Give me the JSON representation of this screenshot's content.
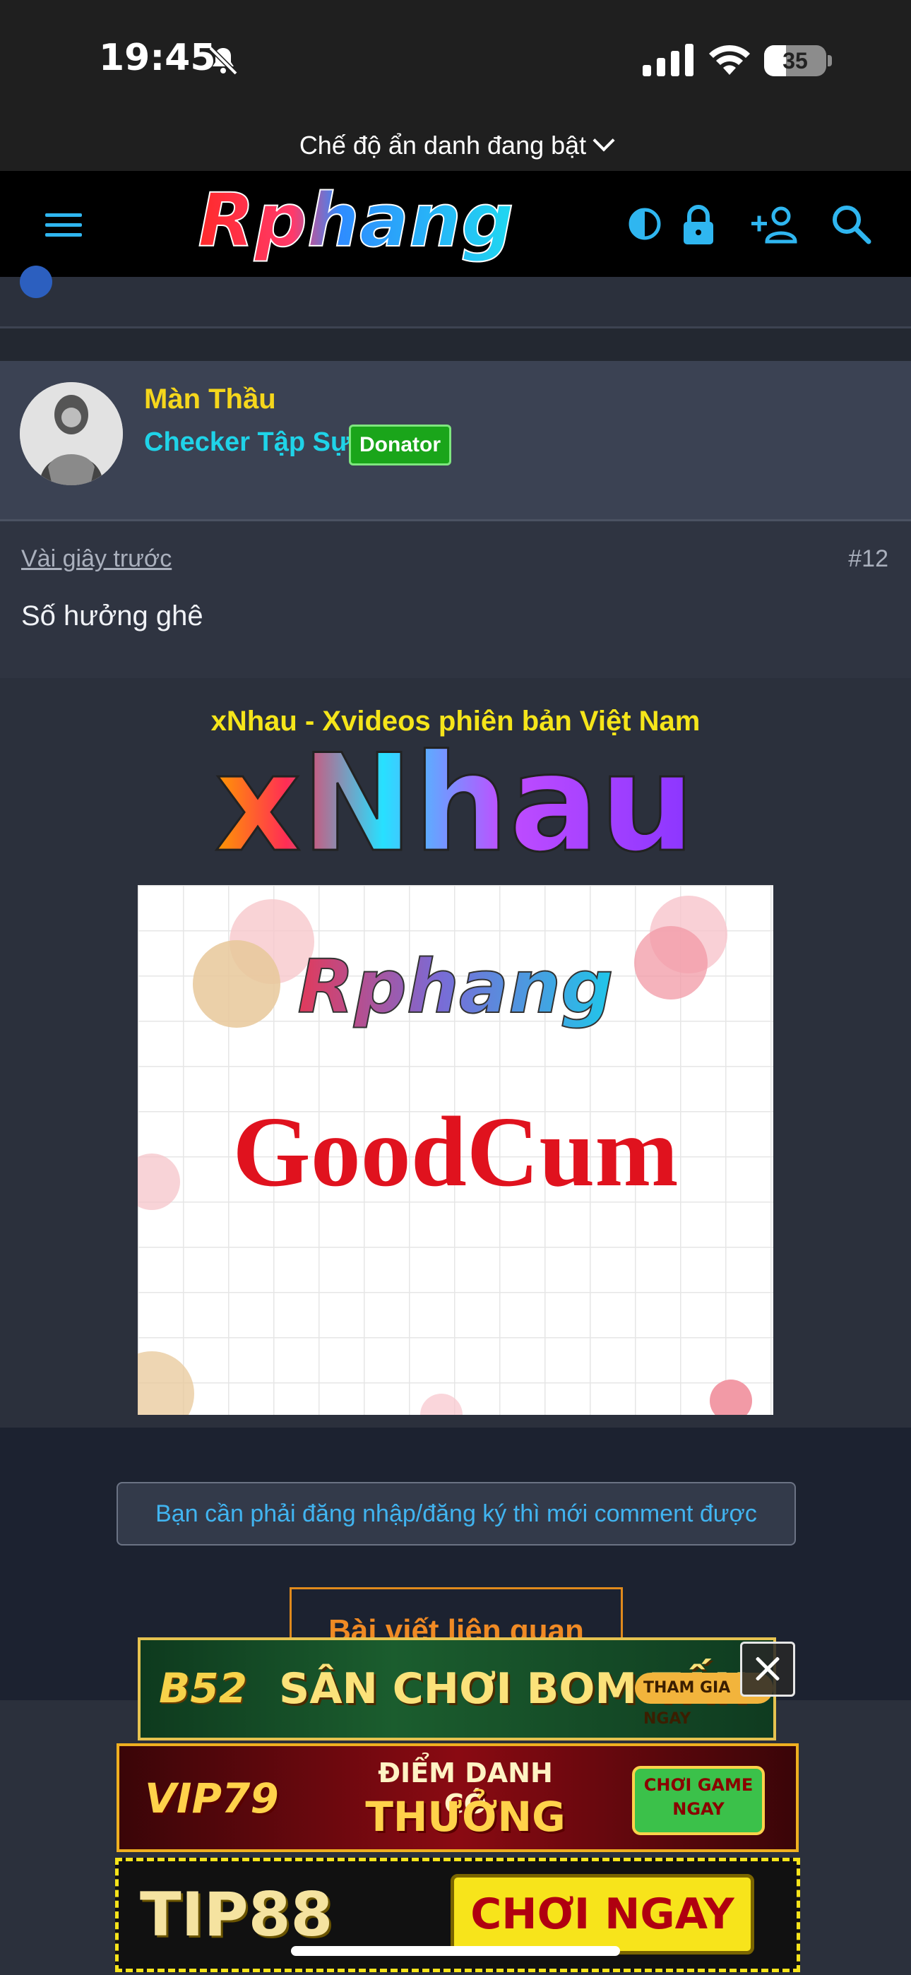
{
  "status_bar": {
    "time": "19:45",
    "battery": "35",
    "battery_level": 0.35
  },
  "browser": {
    "incognito_label": "Chế độ ẩn danh đang bật"
  },
  "header": {
    "logo_text": "Rphang",
    "icons": [
      "menu-icon",
      "contrast-toggle-icon",
      "lock-icon",
      "add-user-icon",
      "search-icon"
    ]
  },
  "post": {
    "username": "Màn Thầu",
    "user_title": "Checker Tập Sự",
    "badge": "Donator",
    "time": "Vài giây trước",
    "post_number": "#12",
    "body": "Số hưởng ghê"
  },
  "ad": {
    "caption": "xNhau - Xvideos phiên bản Việt Nam",
    "brand": "xNhau",
    "image_logo": "Rphang",
    "image_text": "GoodCum"
  },
  "comments": {
    "login_notice": "Bạn cần phải đăng nhập/đăng ký thì mới comment được",
    "related_label": "Bài viết liên quan"
  },
  "banners": {
    "b52": {
      "logo": "B52",
      "headline": "SÂN CHƠI BOM TẤN",
      "cta": "THAM GIA NGAY"
    },
    "vip79": {
      "logo": "VIP79",
      "line1": "ĐIỂM DANH CÓ",
      "line2": "THƯỞNG",
      "cta": "CHƠI GAME NGAY"
    },
    "tip88": {
      "logo": "TIP88",
      "cta": "CHƠI NGAY"
    }
  },
  "colors": {
    "header_bg": "#000000",
    "accent_blue": "#2fb6f0",
    "username": "#f5d61c",
    "user_title": "#1fd3e8",
    "badge_green": "#1aa51a",
    "related_orange": "#f08a24"
  }
}
